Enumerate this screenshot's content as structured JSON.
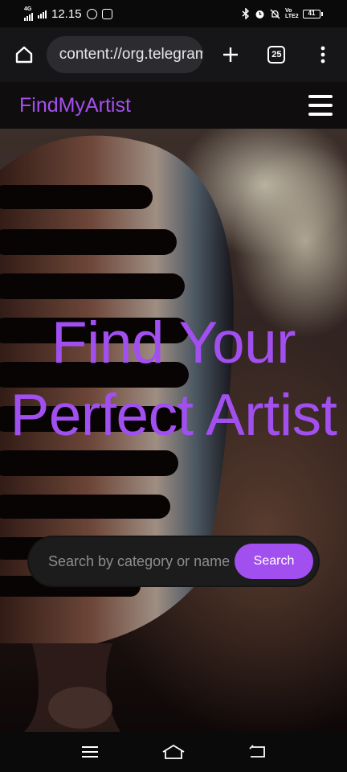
{
  "status_bar": {
    "network": "4G",
    "time": "12.15",
    "volte": "Vo LTE2",
    "battery": "41"
  },
  "browser": {
    "url": "content://org.telegram",
    "tab_count": "25"
  },
  "site": {
    "brand": "FindMyArtist"
  },
  "hero": {
    "title": "Find Your Perfect Artist",
    "search_placeholder": "Search by category or name",
    "search_button": "Search"
  },
  "colors": {
    "accent": "#a24ff0",
    "header_bg": "#0f0d0e",
    "browser_bg": "#161618"
  },
  "icons": {
    "status": [
      "whatsapp-icon",
      "camera-icon",
      "bluetooth-icon",
      "alarm-icon",
      "mute-icon",
      "battery-icon"
    ],
    "browser": [
      "home-icon",
      "info-icon",
      "new-tab-icon",
      "tab-switcher-icon",
      "more-icon"
    ],
    "site": [
      "hamburger-menu-icon"
    ],
    "nav": [
      "recent-apps-icon",
      "home-nav-icon",
      "back-icon"
    ]
  }
}
